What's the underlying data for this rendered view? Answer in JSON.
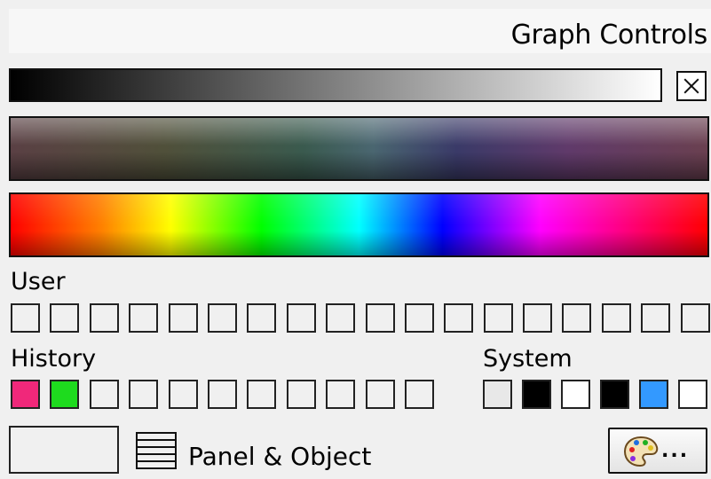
{
  "header": {
    "title": "Graph Controls"
  },
  "gradients": {
    "grayscale": [
      "#000000",
      "#ffffff"
    ],
    "tone": [
      "#5a4044",
      "#50503a",
      "#3a5a4e",
      "#4a6670",
      "#3a3a68",
      "#603a6a",
      "#6a4050"
    ],
    "hue": [
      "#ff0000",
      "#ff8000",
      "#ffff00",
      "#00ff00",
      "#00ffff",
      "#0000ff",
      "#ff00ff",
      "#ff0080",
      "#ff0000"
    ]
  },
  "user": {
    "label": "User",
    "swatches": [
      "#f0f0f0",
      "#f0f0f0",
      "#f0f0f0",
      "#f0f0f0",
      "#f0f0f0",
      "#f0f0f0",
      "#f0f0f0",
      "#f0f0f0",
      "#f0f0f0",
      "#f0f0f0",
      "#f0f0f0",
      "#f0f0f0",
      "#f0f0f0",
      "#f0f0f0",
      "#f0f0f0",
      "#f0f0f0",
      "#f0f0f0",
      "#f0f0f0"
    ]
  },
  "history": {
    "label": "History",
    "swatches": [
      "#f0287a",
      "#1edb1e",
      "#f0f0f0",
      "#f0f0f0",
      "#f0f0f0",
      "#f0f0f0",
      "#f0f0f0",
      "#f0f0f0",
      "#f0f0f0",
      "#f0f0f0",
      "#f0f0f0"
    ]
  },
  "system": {
    "label": "System",
    "swatches": [
      "#e8e8e8",
      "#000000",
      "#ffffff",
      "#000000",
      "#3399ff",
      "#ffffff"
    ]
  },
  "footer": {
    "panel_label": "Panel & Object",
    "list_icon": "list-icon",
    "palette_icon": "palette-icon",
    "palette_dots": "..."
  }
}
